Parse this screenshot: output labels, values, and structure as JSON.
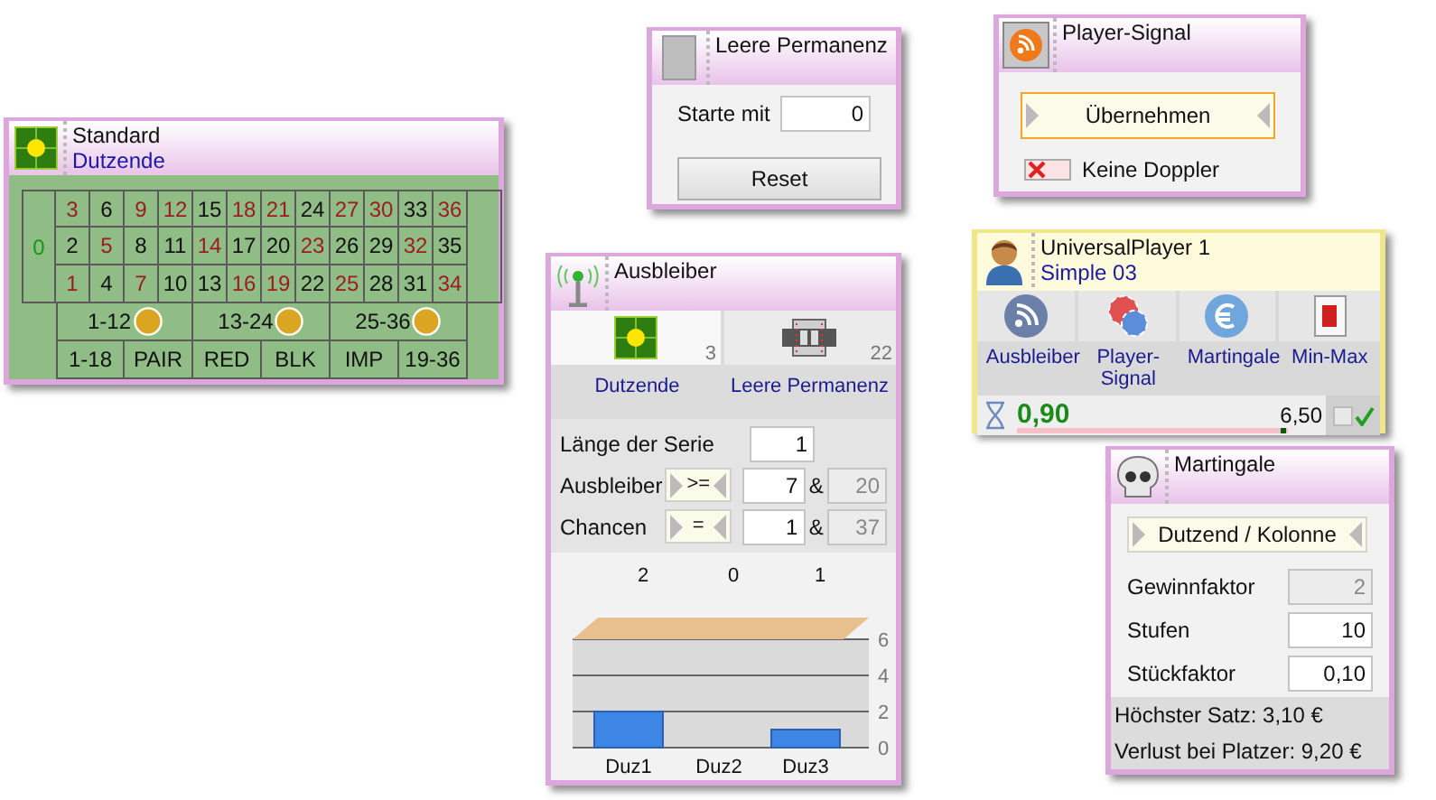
{
  "standard": {
    "title": "Standard",
    "subtitle": "Dutzende",
    "zero": {
      "label": "0",
      "kind": "green"
    },
    "numbers": [
      [
        {
          "label": "3",
          "kind": "red"
        },
        {
          "label": "6",
          "kind": "black"
        },
        {
          "label": "9",
          "kind": "red"
        },
        {
          "label": "12",
          "kind": "red"
        },
        {
          "label": "15",
          "kind": "black"
        },
        {
          "label": "18",
          "kind": "red"
        },
        {
          "label": "21",
          "kind": "red"
        },
        {
          "label": "24",
          "kind": "black"
        },
        {
          "label": "27",
          "kind": "red"
        },
        {
          "label": "30",
          "kind": "red"
        },
        {
          "label": "33",
          "kind": "black"
        },
        {
          "label": "36",
          "kind": "red"
        }
      ],
      [
        {
          "label": "2",
          "kind": "black"
        },
        {
          "label": "5",
          "kind": "red"
        },
        {
          "label": "8",
          "kind": "black"
        },
        {
          "label": "11",
          "kind": "black"
        },
        {
          "label": "14",
          "kind": "red"
        },
        {
          "label": "17",
          "kind": "black"
        },
        {
          "label": "20",
          "kind": "black"
        },
        {
          "label": "23",
          "kind": "red"
        },
        {
          "label": "26",
          "kind": "black"
        },
        {
          "label": "29",
          "kind": "black"
        },
        {
          "label": "32",
          "kind": "red"
        },
        {
          "label": "35",
          "kind": "black"
        }
      ],
      [
        {
          "label": "1",
          "kind": "red"
        },
        {
          "label": "4",
          "kind": "black"
        },
        {
          "label": "7",
          "kind": "red"
        },
        {
          "label": "10",
          "kind": "black"
        },
        {
          "label": "13",
          "kind": "black"
        },
        {
          "label": "16",
          "kind": "red"
        },
        {
          "label": "19",
          "kind": "red"
        },
        {
          "label": "22",
          "kind": "black"
        },
        {
          "label": "25",
          "kind": "red"
        },
        {
          "label": "28",
          "kind": "black"
        },
        {
          "label": "31",
          "kind": "black"
        },
        {
          "label": "34",
          "kind": "red"
        }
      ]
    ],
    "dozens": [
      {
        "label": "1-12",
        "chip": true
      },
      {
        "label": "13-24",
        "chip": true
      },
      {
        "label": "25-36",
        "chip": true
      }
    ],
    "even_chances": [
      "1-18",
      "PAIR",
      "RED",
      "BLK",
      "IMP",
      "19-36"
    ]
  },
  "leere_permanenz": {
    "title": "Leere Permanenz",
    "start_label": "Starte mit",
    "start_value": "0",
    "reset_button": "Reset"
  },
  "player_signal": {
    "title": "Player-Signal",
    "apply_button": "Übernehmen",
    "no_doubles": {
      "label": "Keine Doppler",
      "checked": false
    }
  },
  "ausbleiber": {
    "title": "Ausbleiber",
    "sources": [
      {
        "label": "Dutzende",
        "count": "3",
        "selected": true
      },
      {
        "label": "Leere Permanenz",
        "count": "22",
        "selected": false
      }
    ],
    "series_length": {
      "label": "Länge der Serie",
      "value": "1"
    },
    "rows": [
      {
        "label": "Ausbleiber",
        "operator": ">=",
        "value": "7",
        "separator": "&",
        "limit": "20"
      },
      {
        "label": "Chancen",
        "operator": "=",
        "value": "1",
        "separator": "&",
        "limit": "37"
      }
    ],
    "chart_data": {
      "type": "bar",
      "categories": [
        "Duz1",
        "Duz2",
        "Duz3"
      ],
      "series": [
        {
          "color": "#3d86e6",
          "values": [
            2,
            0,
            1
          ]
        }
      ],
      "ylim": [
        0,
        6
      ],
      "yticks": [
        0,
        2,
        4,
        6
      ]
    },
    "column_labels": [
      "2",
      "0",
      "1"
    ]
  },
  "universal_player": {
    "title": "UniversalPlayer 1",
    "subtitle": "Simple 03",
    "tools": [
      {
        "label": "Ausbleiber"
      },
      {
        "label": "Player-Signal"
      },
      {
        "label": "Martingale"
      },
      {
        "label": "Min-Max"
      }
    ],
    "balance": "0,90",
    "progress": {
      "level": 0.97
    },
    "stake": "6,50",
    "active": {
      "checked": true
    }
  },
  "martingale": {
    "title": "Martingale",
    "mode": "Dutzend / Kolonne",
    "fields": [
      {
        "label": "Gewinnfaktor",
        "value": "2",
        "disabled": true
      },
      {
        "label": "Stufen",
        "value": "10",
        "disabled": false
      },
      {
        "label": "Stückfaktor",
        "value": "0,10",
        "disabled": false
      }
    ],
    "max_bet": "Höchster Satz: 3,10 €",
    "loss": "Verlust bei Platzer: 9,20 €"
  }
}
